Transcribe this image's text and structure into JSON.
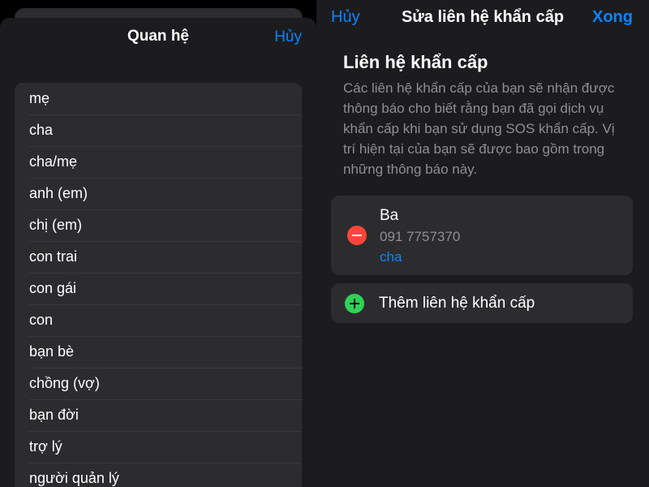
{
  "relationship_sheet": {
    "title": "Quan hệ",
    "cancel_label": "Hủy",
    "items": [
      "mẹ",
      "cha",
      "cha/mẹ",
      "anh (em)",
      "chị (em)",
      "con trai",
      "con gái",
      "con",
      "bạn bè",
      "chồng (vợ)",
      "bạn đời",
      "trợ lý",
      "người quản lý"
    ]
  },
  "emergency_editor": {
    "nav": {
      "cancel_label": "Hủy",
      "title": "Sửa liên hệ khẩn cấp",
      "done_label": "Xong"
    },
    "section_title": "Liên hệ khẩn cấp",
    "section_description": "Các liên hệ khẩn cấp của bạn sẽ nhận được thông báo cho biết rằng bạn đã gọi dịch vụ khẩn cấp khi bạn sử dụng SOS khẩn cấp. Vị trí hiện tại của bạn sẽ được bao gồm trong những thông báo này.",
    "contact": {
      "name": "Ba",
      "phone": "091 7757370",
      "relationship": "cha"
    },
    "add_contact_label": "Thêm liên hệ khẩn cấp"
  },
  "colors": {
    "accent_blue": "#0a84ff",
    "remove_red": "#ff453a",
    "add_green": "#30d158"
  }
}
